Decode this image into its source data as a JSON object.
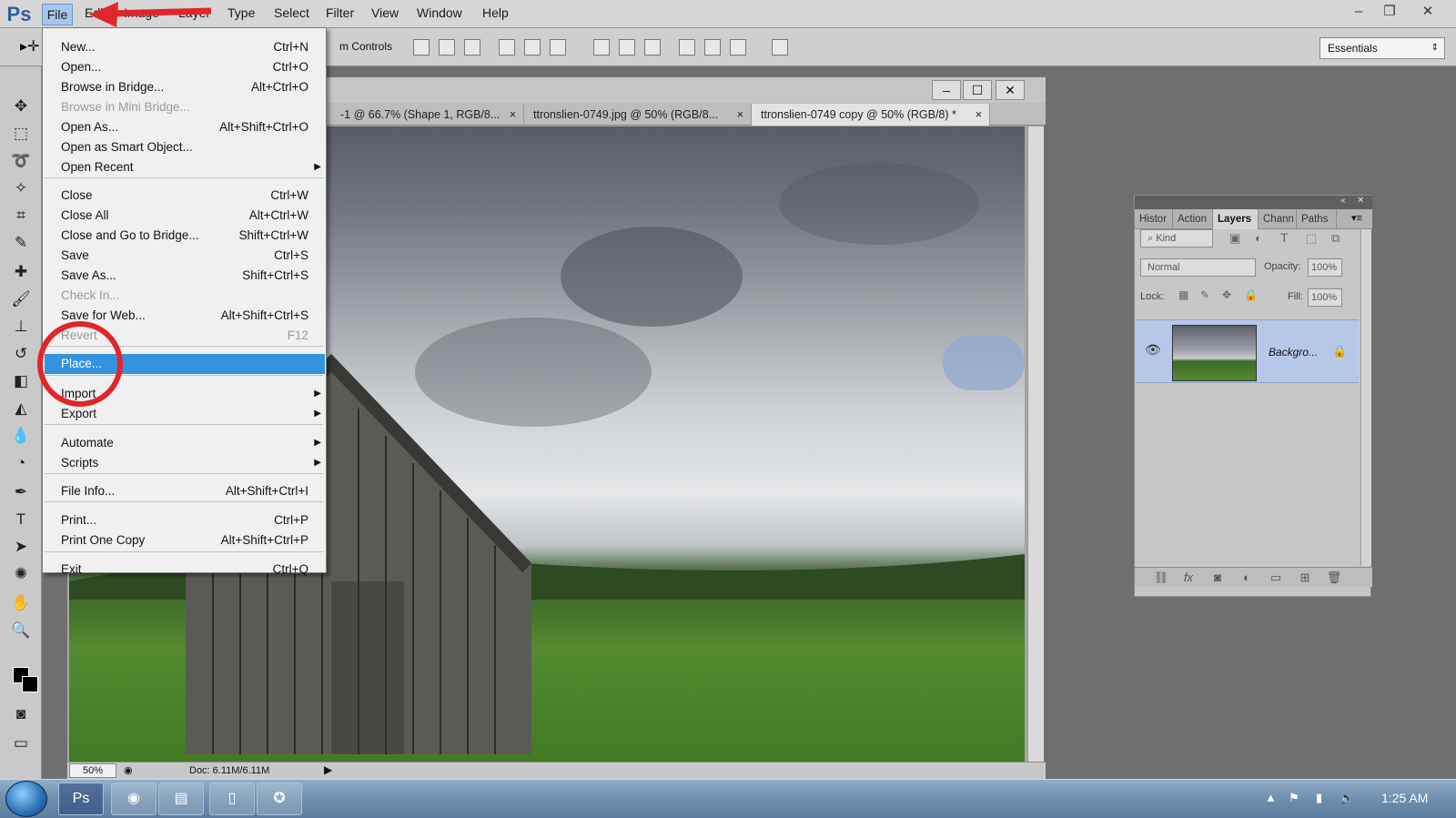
{
  "app": {
    "logo": "Ps"
  },
  "menubar": {
    "items": [
      "File",
      "Edit",
      "Image",
      "Layer",
      "Type",
      "Select",
      "Filter",
      "View",
      "Window",
      "Help"
    ],
    "window_controls": [
      "–",
      "❐",
      "✕"
    ]
  },
  "options": {
    "controls_label": "m Controls",
    "workspace": "Essentials"
  },
  "file_menu": {
    "items": [
      {
        "label": "New...",
        "shortcut": "Ctrl+N"
      },
      {
        "label": "Open...",
        "shortcut": "Ctrl+O"
      },
      {
        "label": "Browse in Bridge...",
        "shortcut": "Alt+Ctrl+O"
      },
      {
        "label": "Browse in Mini Bridge...",
        "shortcut": ""
      },
      {
        "label": "Open As...",
        "shortcut": "Alt+Shift+Ctrl+O"
      },
      {
        "label": "Open as Smart Object...",
        "shortcut": ""
      },
      {
        "label": "Open Recent",
        "shortcut": ""
      },
      {
        "label": "Close",
        "shortcut": "Ctrl+W"
      },
      {
        "label": "Close All",
        "shortcut": "Alt+Ctrl+W"
      },
      {
        "label": "Close and Go to Bridge...",
        "shortcut": "Shift+Ctrl+W"
      },
      {
        "label": "Save",
        "shortcut": "Ctrl+S"
      },
      {
        "label": "Save As...",
        "shortcut": "Shift+Ctrl+S"
      },
      {
        "label": "Check In...",
        "shortcut": ""
      },
      {
        "label": "Save for Web...",
        "shortcut": "Alt+Shift+Ctrl+S"
      },
      {
        "label": "Revert",
        "shortcut": "F12"
      },
      {
        "label": "Place...",
        "shortcut": ""
      },
      {
        "label": "Import",
        "shortcut": ""
      },
      {
        "label": "Export",
        "shortcut": ""
      },
      {
        "label": "Automate",
        "shortcut": ""
      },
      {
        "label": "Scripts",
        "shortcut": ""
      },
      {
        "label": "File Info...",
        "shortcut": "Alt+Shift+Ctrl+I"
      },
      {
        "label": "Print...",
        "shortcut": "Ctrl+P"
      },
      {
        "label": "Print One Copy",
        "shortcut": "Alt+Shift+Ctrl+P"
      },
      {
        "label": "Exit",
        "shortcut": "Ctrl+Q"
      }
    ]
  },
  "document": {
    "tabs": [
      "-1 @ 66.7% (Shape 1, RGB/8...",
      "ttronslien-0749.jpg @ 50% (RGB/8...",
      "ttronslien-0749 copy @ 50% (RGB/8) *"
    ],
    "zoom": "50%",
    "doc_size": "Doc: 6.11M/6.11M"
  },
  "layers_panel": {
    "tabs": [
      "Histor",
      "Action",
      "Layers",
      "Chann",
      "Paths"
    ],
    "kind_filter": "Kind",
    "blend_mode": "Normal",
    "opacity_label": "Opacity:",
    "opacity": "100%",
    "lock_label": "Lock:",
    "fill_label": "Fill:",
    "fill": "100%",
    "layer_name": "Backgro..."
  },
  "taskbar": {
    "time": "1:25 AM"
  },
  "colors": {
    "menu_highlight": "#3393df",
    "annotation": "#e0262a",
    "layer_selected": "#b6c8e8"
  }
}
